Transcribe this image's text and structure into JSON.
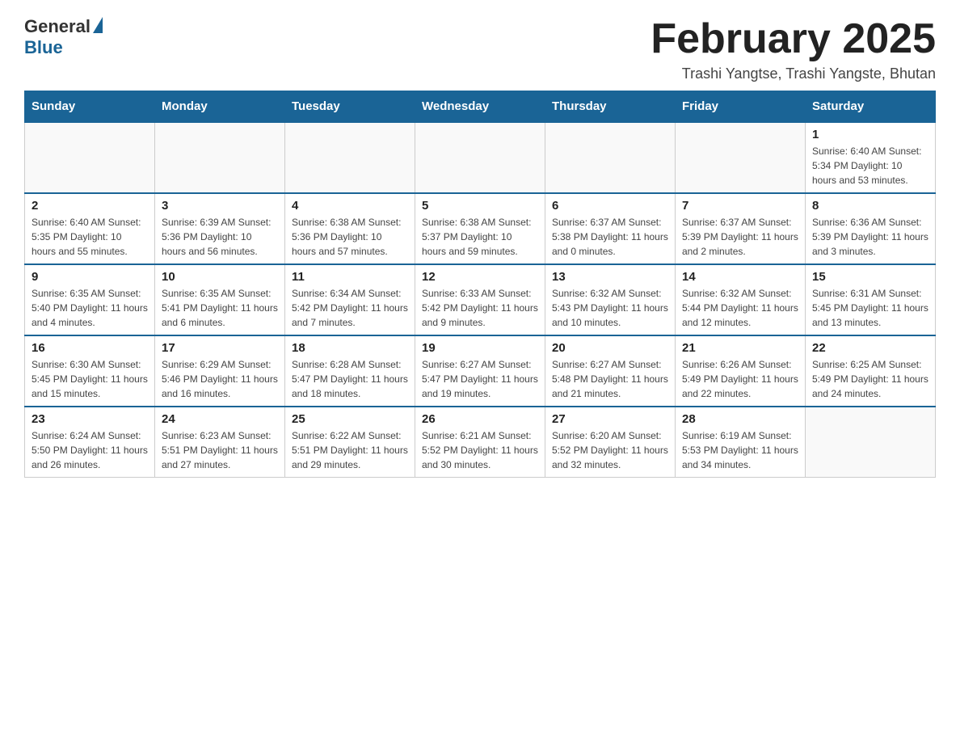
{
  "header": {
    "logo_general": "General",
    "logo_blue": "Blue",
    "month_year": "February 2025",
    "location": "Trashi Yangtse, Trashi Yangste, Bhutan"
  },
  "days_of_week": [
    "Sunday",
    "Monday",
    "Tuesday",
    "Wednesday",
    "Thursday",
    "Friday",
    "Saturday"
  ],
  "weeks": [
    [
      {
        "day": "",
        "info": ""
      },
      {
        "day": "",
        "info": ""
      },
      {
        "day": "",
        "info": ""
      },
      {
        "day": "",
        "info": ""
      },
      {
        "day": "",
        "info": ""
      },
      {
        "day": "",
        "info": ""
      },
      {
        "day": "1",
        "info": "Sunrise: 6:40 AM\nSunset: 5:34 PM\nDaylight: 10 hours and 53 minutes."
      }
    ],
    [
      {
        "day": "2",
        "info": "Sunrise: 6:40 AM\nSunset: 5:35 PM\nDaylight: 10 hours and 55 minutes."
      },
      {
        "day": "3",
        "info": "Sunrise: 6:39 AM\nSunset: 5:36 PM\nDaylight: 10 hours and 56 minutes."
      },
      {
        "day": "4",
        "info": "Sunrise: 6:38 AM\nSunset: 5:36 PM\nDaylight: 10 hours and 57 minutes."
      },
      {
        "day": "5",
        "info": "Sunrise: 6:38 AM\nSunset: 5:37 PM\nDaylight: 10 hours and 59 minutes."
      },
      {
        "day": "6",
        "info": "Sunrise: 6:37 AM\nSunset: 5:38 PM\nDaylight: 11 hours and 0 minutes."
      },
      {
        "day": "7",
        "info": "Sunrise: 6:37 AM\nSunset: 5:39 PM\nDaylight: 11 hours and 2 minutes."
      },
      {
        "day": "8",
        "info": "Sunrise: 6:36 AM\nSunset: 5:39 PM\nDaylight: 11 hours and 3 minutes."
      }
    ],
    [
      {
        "day": "9",
        "info": "Sunrise: 6:35 AM\nSunset: 5:40 PM\nDaylight: 11 hours and 4 minutes."
      },
      {
        "day": "10",
        "info": "Sunrise: 6:35 AM\nSunset: 5:41 PM\nDaylight: 11 hours and 6 minutes."
      },
      {
        "day": "11",
        "info": "Sunrise: 6:34 AM\nSunset: 5:42 PM\nDaylight: 11 hours and 7 minutes."
      },
      {
        "day": "12",
        "info": "Sunrise: 6:33 AM\nSunset: 5:42 PM\nDaylight: 11 hours and 9 minutes."
      },
      {
        "day": "13",
        "info": "Sunrise: 6:32 AM\nSunset: 5:43 PM\nDaylight: 11 hours and 10 minutes."
      },
      {
        "day": "14",
        "info": "Sunrise: 6:32 AM\nSunset: 5:44 PM\nDaylight: 11 hours and 12 minutes."
      },
      {
        "day": "15",
        "info": "Sunrise: 6:31 AM\nSunset: 5:45 PM\nDaylight: 11 hours and 13 minutes."
      }
    ],
    [
      {
        "day": "16",
        "info": "Sunrise: 6:30 AM\nSunset: 5:45 PM\nDaylight: 11 hours and 15 minutes."
      },
      {
        "day": "17",
        "info": "Sunrise: 6:29 AM\nSunset: 5:46 PM\nDaylight: 11 hours and 16 minutes."
      },
      {
        "day": "18",
        "info": "Sunrise: 6:28 AM\nSunset: 5:47 PM\nDaylight: 11 hours and 18 minutes."
      },
      {
        "day": "19",
        "info": "Sunrise: 6:27 AM\nSunset: 5:47 PM\nDaylight: 11 hours and 19 minutes."
      },
      {
        "day": "20",
        "info": "Sunrise: 6:27 AM\nSunset: 5:48 PM\nDaylight: 11 hours and 21 minutes."
      },
      {
        "day": "21",
        "info": "Sunrise: 6:26 AM\nSunset: 5:49 PM\nDaylight: 11 hours and 22 minutes."
      },
      {
        "day": "22",
        "info": "Sunrise: 6:25 AM\nSunset: 5:49 PM\nDaylight: 11 hours and 24 minutes."
      }
    ],
    [
      {
        "day": "23",
        "info": "Sunrise: 6:24 AM\nSunset: 5:50 PM\nDaylight: 11 hours and 26 minutes."
      },
      {
        "day": "24",
        "info": "Sunrise: 6:23 AM\nSunset: 5:51 PM\nDaylight: 11 hours and 27 minutes."
      },
      {
        "day": "25",
        "info": "Sunrise: 6:22 AM\nSunset: 5:51 PM\nDaylight: 11 hours and 29 minutes."
      },
      {
        "day": "26",
        "info": "Sunrise: 6:21 AM\nSunset: 5:52 PM\nDaylight: 11 hours and 30 minutes."
      },
      {
        "day": "27",
        "info": "Sunrise: 6:20 AM\nSunset: 5:52 PM\nDaylight: 11 hours and 32 minutes."
      },
      {
        "day": "28",
        "info": "Sunrise: 6:19 AM\nSunset: 5:53 PM\nDaylight: 11 hours and 34 minutes."
      },
      {
        "day": "",
        "info": ""
      }
    ]
  ]
}
